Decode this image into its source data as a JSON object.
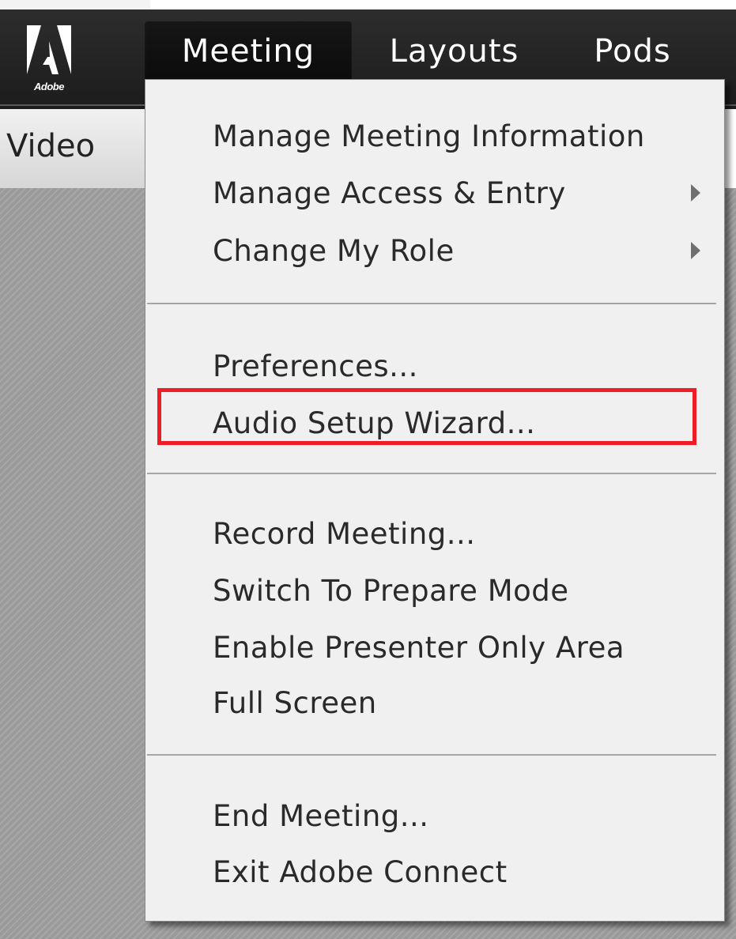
{
  "app": {
    "logo_text": "Adobe"
  },
  "menubar": {
    "items": [
      {
        "label": "Meeting",
        "active": true
      },
      {
        "label": "Layouts",
        "active": false
      },
      {
        "label": "Pods",
        "active": false
      }
    ]
  },
  "pod": {
    "title": "Video"
  },
  "dropdown": {
    "groups": [
      [
        {
          "label": "Manage Meeting Information",
          "submenu": false
        },
        {
          "label": "Manage Access & Entry",
          "submenu": true
        },
        {
          "label": "Change My Role",
          "submenu": true
        }
      ],
      [
        {
          "label": "Preferences...",
          "submenu": false
        },
        {
          "label": "Audio Setup Wizard...",
          "submenu": false,
          "highlighted": true
        }
      ],
      [
        {
          "label": "Record Meeting...",
          "submenu": false
        },
        {
          "label": "Switch To Prepare Mode",
          "submenu": false
        },
        {
          "label": "Enable Presenter Only Area",
          "submenu": false
        },
        {
          "label": "Full Screen",
          "submenu": false
        }
      ],
      [
        {
          "label": "End Meeting...",
          "submenu": false
        },
        {
          "label": "Exit Adobe Connect",
          "submenu": false
        }
      ]
    ]
  },
  "colors": {
    "highlight_border": "#ee1c24",
    "menubar_bg": "#1c1c1c",
    "menu_bg": "#f0f0f0"
  }
}
